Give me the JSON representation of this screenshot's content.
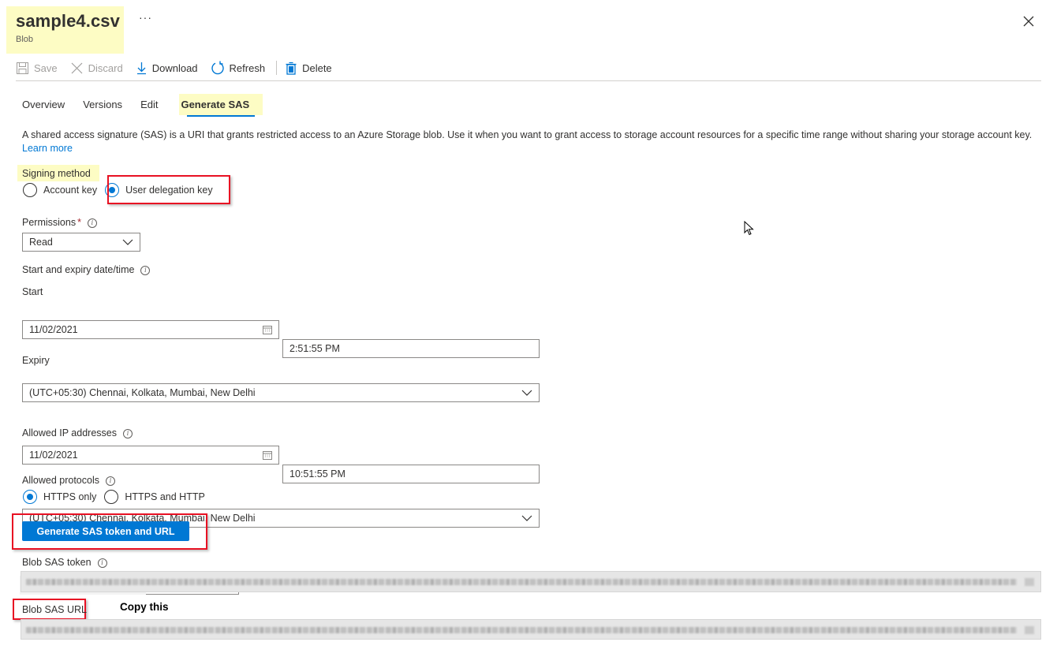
{
  "header": {
    "title": "sample4.csv",
    "subtitle": "Blob",
    "more_label": "···",
    "close_icon": "close-icon"
  },
  "toolbar": {
    "save": "Save",
    "discard": "Discard",
    "download": "Download",
    "refresh": "Refresh",
    "delete": "Delete"
  },
  "tabs": [
    {
      "label": "Overview",
      "active": false
    },
    {
      "label": "Versions",
      "active": false
    },
    {
      "label": "Edit",
      "active": false
    },
    {
      "label": "Generate SAS",
      "active": true
    }
  ],
  "description": {
    "text": "A shared access signature (SAS) is a URI that grants restricted access to an Azure Storage blob. Use it when you want to grant access to storage account resources for a specific time range without sharing your storage account key.",
    "link": "Learn more"
  },
  "signing_method": {
    "label": "Signing method",
    "options": [
      {
        "label": "Account key",
        "checked": false
      },
      {
        "label": "User delegation key",
        "checked": true
      }
    ]
  },
  "permissions": {
    "label": "Permissions",
    "required_mark": "*",
    "value": "Read"
  },
  "datetime": {
    "label": "Start and expiry date/time",
    "start": {
      "label": "Start",
      "date": "11/02/2021",
      "time": "2:51:55 PM",
      "timezone": "(UTC+05:30) Chennai, Kolkata, Mumbai, New Delhi"
    },
    "expiry": {
      "label": "Expiry",
      "date": "11/02/2021",
      "time": "10:51:55 PM",
      "timezone": "(UTC+05:30) Chennai, Kolkata, Mumbai, New Delhi"
    }
  },
  "allowed_ip": {
    "label": "Allowed IP addresses",
    "value": "",
    "valid": true
  },
  "allowed_protocols": {
    "label": "Allowed protocols",
    "options": [
      {
        "label": "HTTPS only",
        "checked": true
      },
      {
        "label": "HTTPS and HTTP",
        "checked": false
      }
    ]
  },
  "generate_button": "Generate SAS token and URL",
  "sas_token": {
    "label": "Blob SAS token",
    "value": ""
  },
  "sas_url": {
    "label": "Blob SAS URL",
    "value": "",
    "annotation": "Copy this"
  },
  "colors": {
    "accent": "#0078d4",
    "highlight": "#fdfcc4",
    "annotation_red": "#e81123"
  }
}
